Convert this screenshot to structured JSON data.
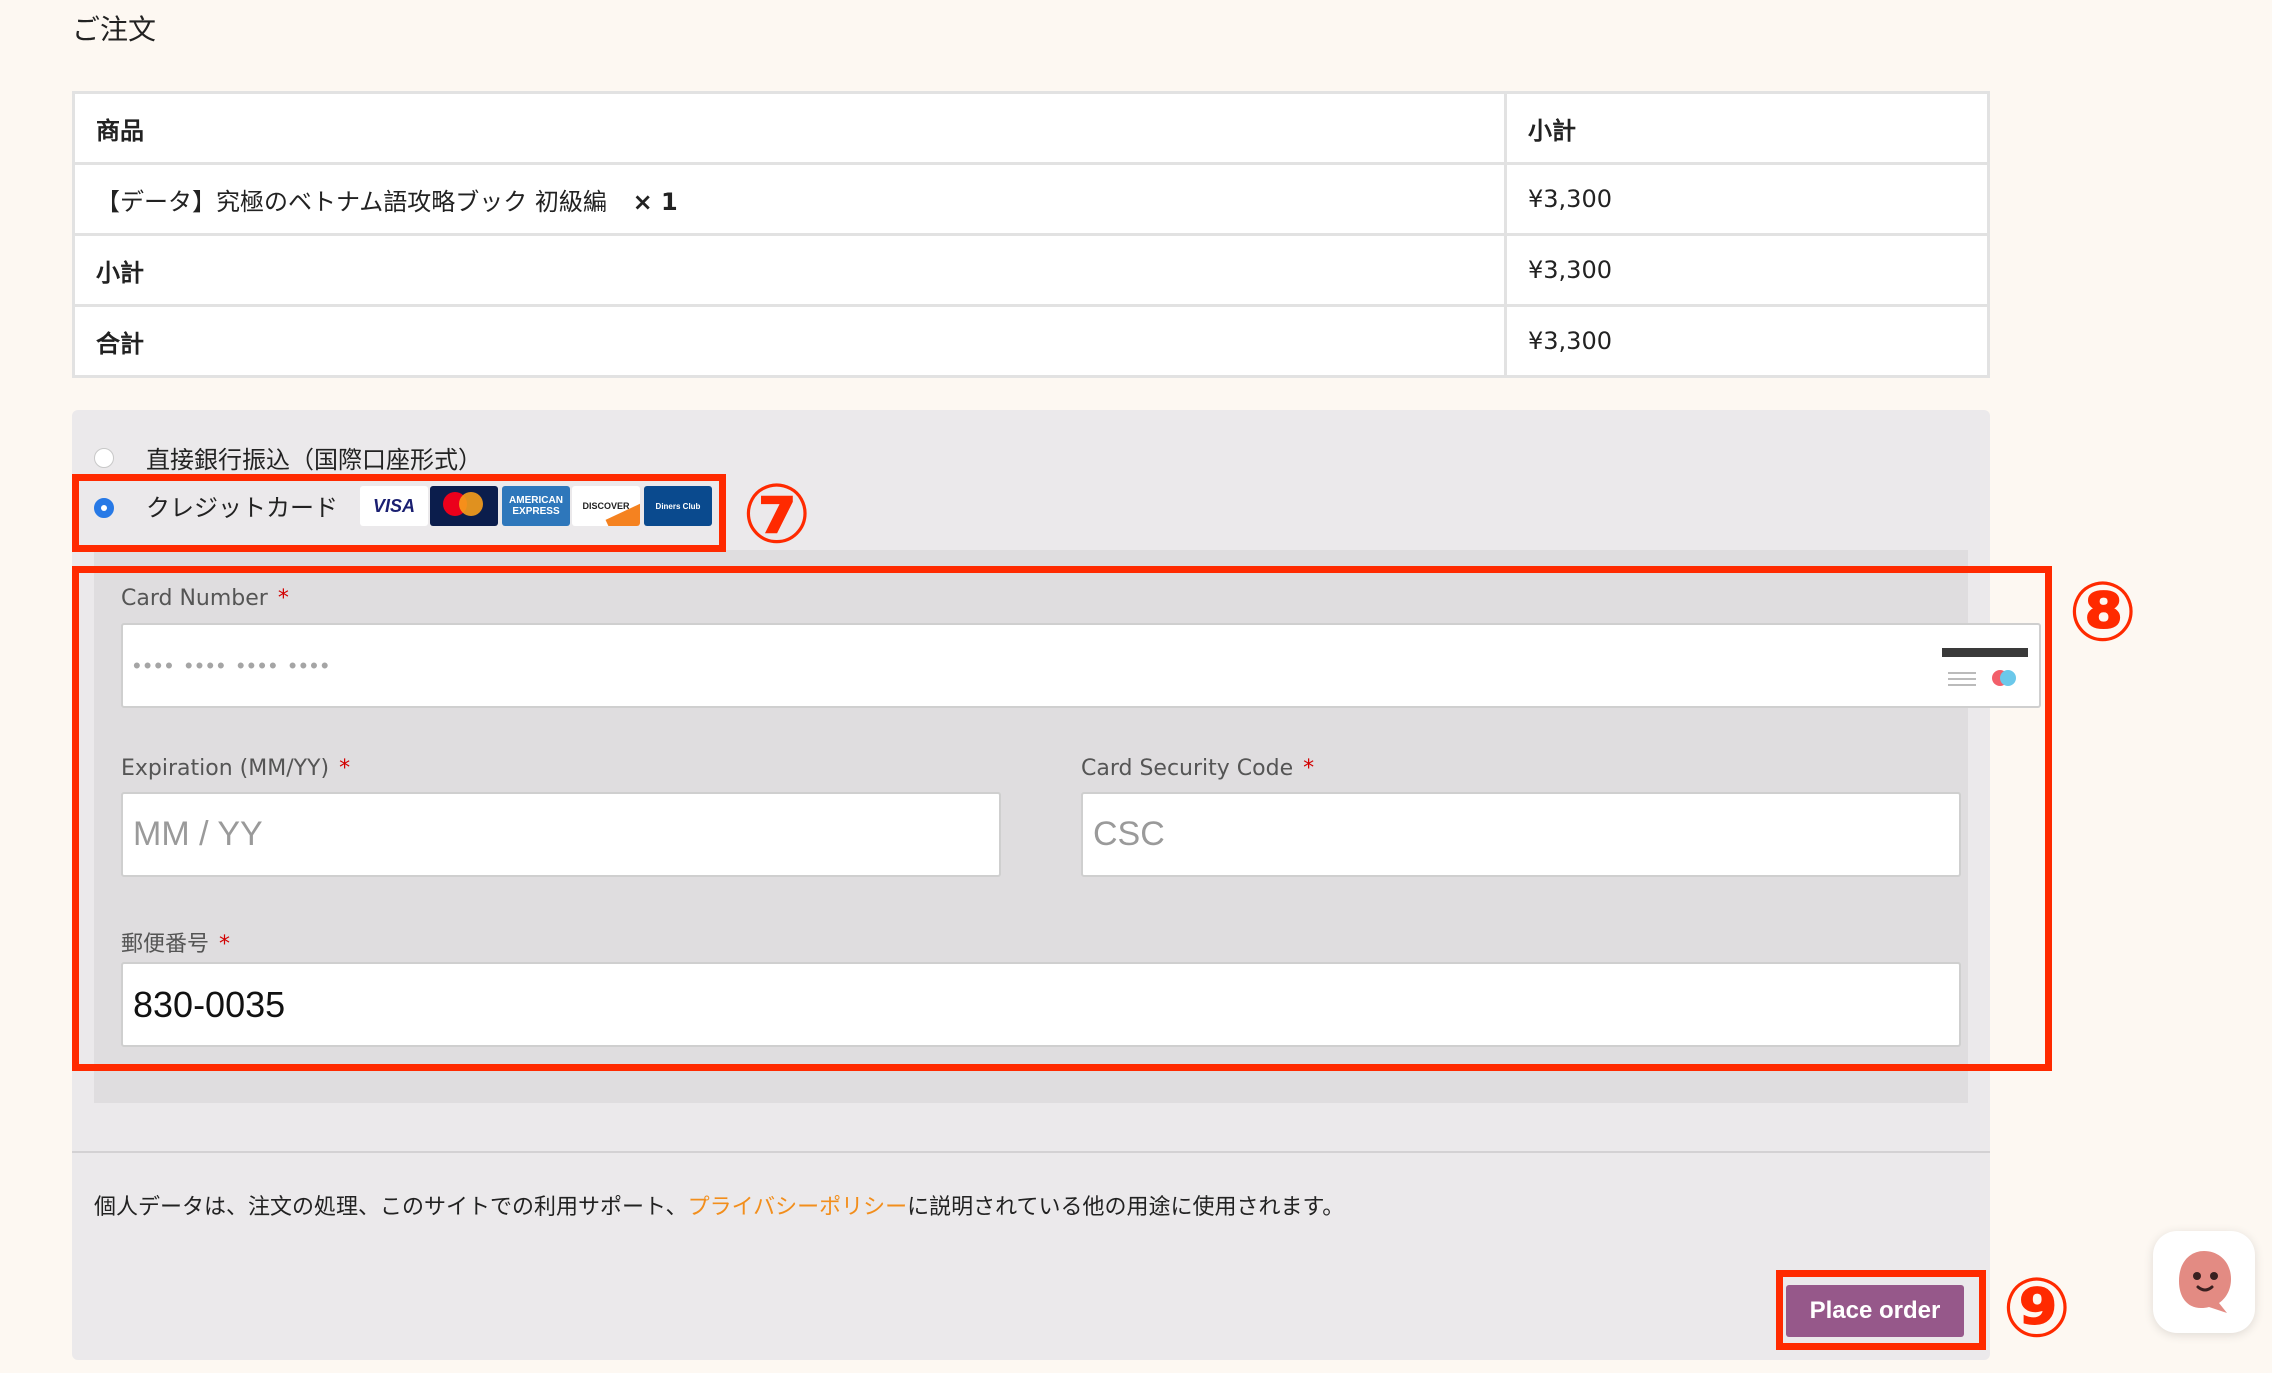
{
  "page": {
    "heading": "ご注文"
  },
  "order_table": {
    "headers": {
      "product": "商品",
      "subtotal": "小計"
    },
    "item": {
      "name": "【データ】究極のベトナム語攻略ブック 初級編",
      "qty": "× 1",
      "price": "¥3,300"
    },
    "subtotal_row": {
      "label": "小計",
      "value": "¥3,300"
    },
    "total_row": {
      "label": "合計",
      "value": "¥3,300"
    }
  },
  "payment": {
    "methods": [
      {
        "label": "直接銀行振込（国際口座形式）",
        "selected": false
      },
      {
        "label": "クレジットカード",
        "selected": true
      }
    ],
    "card_logos": [
      "VISA",
      "mastercard",
      "AMERICAN EXPRESS",
      "DISCOVER",
      "Diners Club"
    ],
    "card_number": {
      "label": "Card Number",
      "placeholder": "•••• •••• •••• ••••"
    },
    "expiration": {
      "label": "Expiration (MM/YY)",
      "placeholder": "MM / YY"
    },
    "csc": {
      "label": "Card Security Code",
      "placeholder": "CSC"
    },
    "postal": {
      "label": "郵便番号",
      "value": "830-0035"
    },
    "required_mark": "*"
  },
  "privacy": {
    "before": "個人データは、注文の処理、このサイトでの利用サポート、",
    "link": "プライバシーポリシー",
    "after": "に説明されている他の用途に使用されます。"
  },
  "place_order": {
    "label": "Place order"
  },
  "annotations": {
    "seven": "⑦",
    "eight": "⑧",
    "nine": "⑨"
  },
  "colors": {
    "accent_button": "#96588a",
    "highlight": "#ff2a00",
    "link": "#f28e1c",
    "radio_selected": "#2779e6"
  }
}
